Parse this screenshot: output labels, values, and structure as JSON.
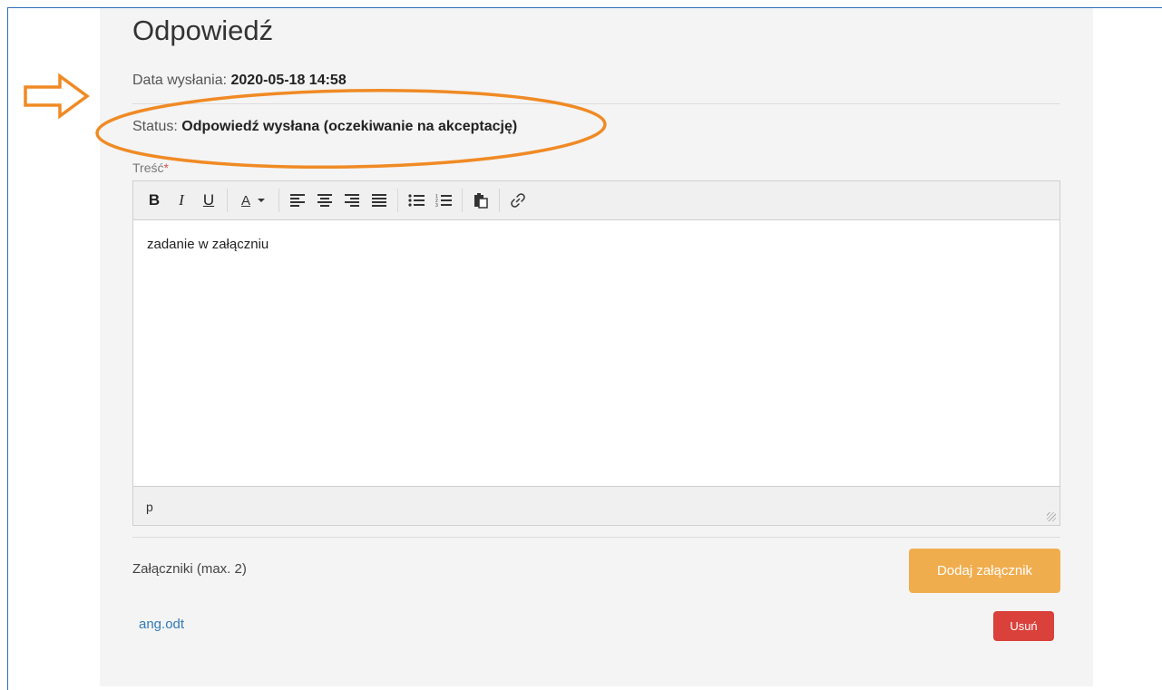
{
  "page": {
    "title": "Odpowiedź",
    "date_label": "Data wysłania:",
    "date_value": "2020-05-18 14:58",
    "status_label": "Status:",
    "status_value": "Odpowiedź wysłana (oczekiwanie na akceptację)"
  },
  "editor": {
    "label": "Treść",
    "required_mark": "*",
    "content": "zadanie w załączniu",
    "path": "p",
    "toolbar": {
      "bold": "B",
      "italic": "I",
      "underline": "U",
      "font_color": "A"
    }
  },
  "attachments": {
    "label": "Załączniki (max. 2)",
    "add_button": "Dodaj załącznik",
    "files": [
      {
        "name": "ang.odt",
        "delete_label": "Usuń"
      }
    ]
  },
  "colors": {
    "annotation": "#f08a24",
    "add_button": "#f0ad4e",
    "delete_button": "#d9413a",
    "link": "#337ab7"
  },
  "icons": [
    "bold-icon",
    "italic-icon",
    "underline-icon",
    "font-color-icon",
    "align-left-icon",
    "align-center-icon",
    "align-right-icon",
    "align-justify-icon",
    "bullet-list-icon",
    "numbered-list-icon",
    "paste-icon",
    "link-icon",
    "arrow-right-icon"
  ]
}
